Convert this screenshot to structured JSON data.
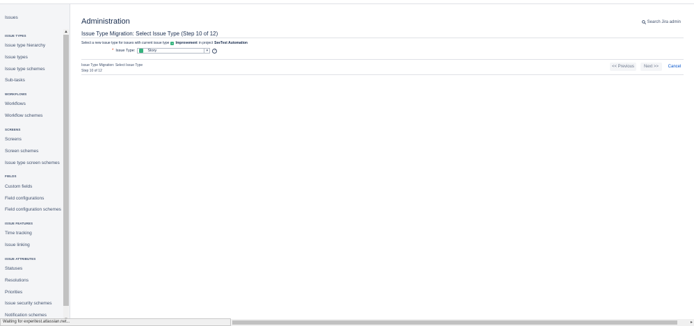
{
  "sidebar": {
    "top_link": "Issues",
    "sections": [
      {
        "heading": "ISSUE TYPES",
        "items": [
          "Issue type hierarchy",
          "Issue types",
          "Issue type schemes",
          "Sub-tasks"
        ]
      },
      {
        "heading": "WORKFLOWS",
        "items": [
          "Workflows",
          "Workflow schemes"
        ]
      },
      {
        "heading": "SCREENS",
        "items": [
          "Screens",
          "Screen schemes",
          "Issue type screen schemes"
        ]
      },
      {
        "heading": "FIELDS",
        "items": [
          "Custom fields",
          "Field configurations",
          "Field configuration schemes"
        ]
      },
      {
        "heading": "ISSUE FEATURES",
        "items": [
          "Time tracking",
          "Issue linking"
        ]
      },
      {
        "heading": "ISSUE ATTRIBUTES",
        "items": [
          "Statuses",
          "Resolutions",
          "Priorities",
          "Issue security schemes",
          "Notification schemes"
        ]
      }
    ]
  },
  "main": {
    "title": "Administration",
    "search_label": "Search Jira admin",
    "section_title": "Issue Type Migration: Select Issue Type (Step 10 of 12)",
    "description": {
      "prefix": "Select a new issue type for issues with current issue type",
      "issue_type": "Improvement",
      "mid": "in project",
      "project": "SeeTest Automation"
    },
    "form": {
      "required_mark": "*",
      "label": "Issue Type:",
      "selected_value": "Story",
      "help_glyph": "?"
    },
    "footer": {
      "line1": "Issue Type Migration: Select Issue Type",
      "line2": "Step 10 of 12"
    },
    "buttons": {
      "previous": "<< Previous",
      "next": "Next >>",
      "cancel": "Cancel"
    }
  },
  "statusbar": {
    "text": "Waiting for experitest.atlassian.net..."
  },
  "colors": {
    "accent": "#0052cc",
    "issue_type_green": "#36b37e"
  }
}
